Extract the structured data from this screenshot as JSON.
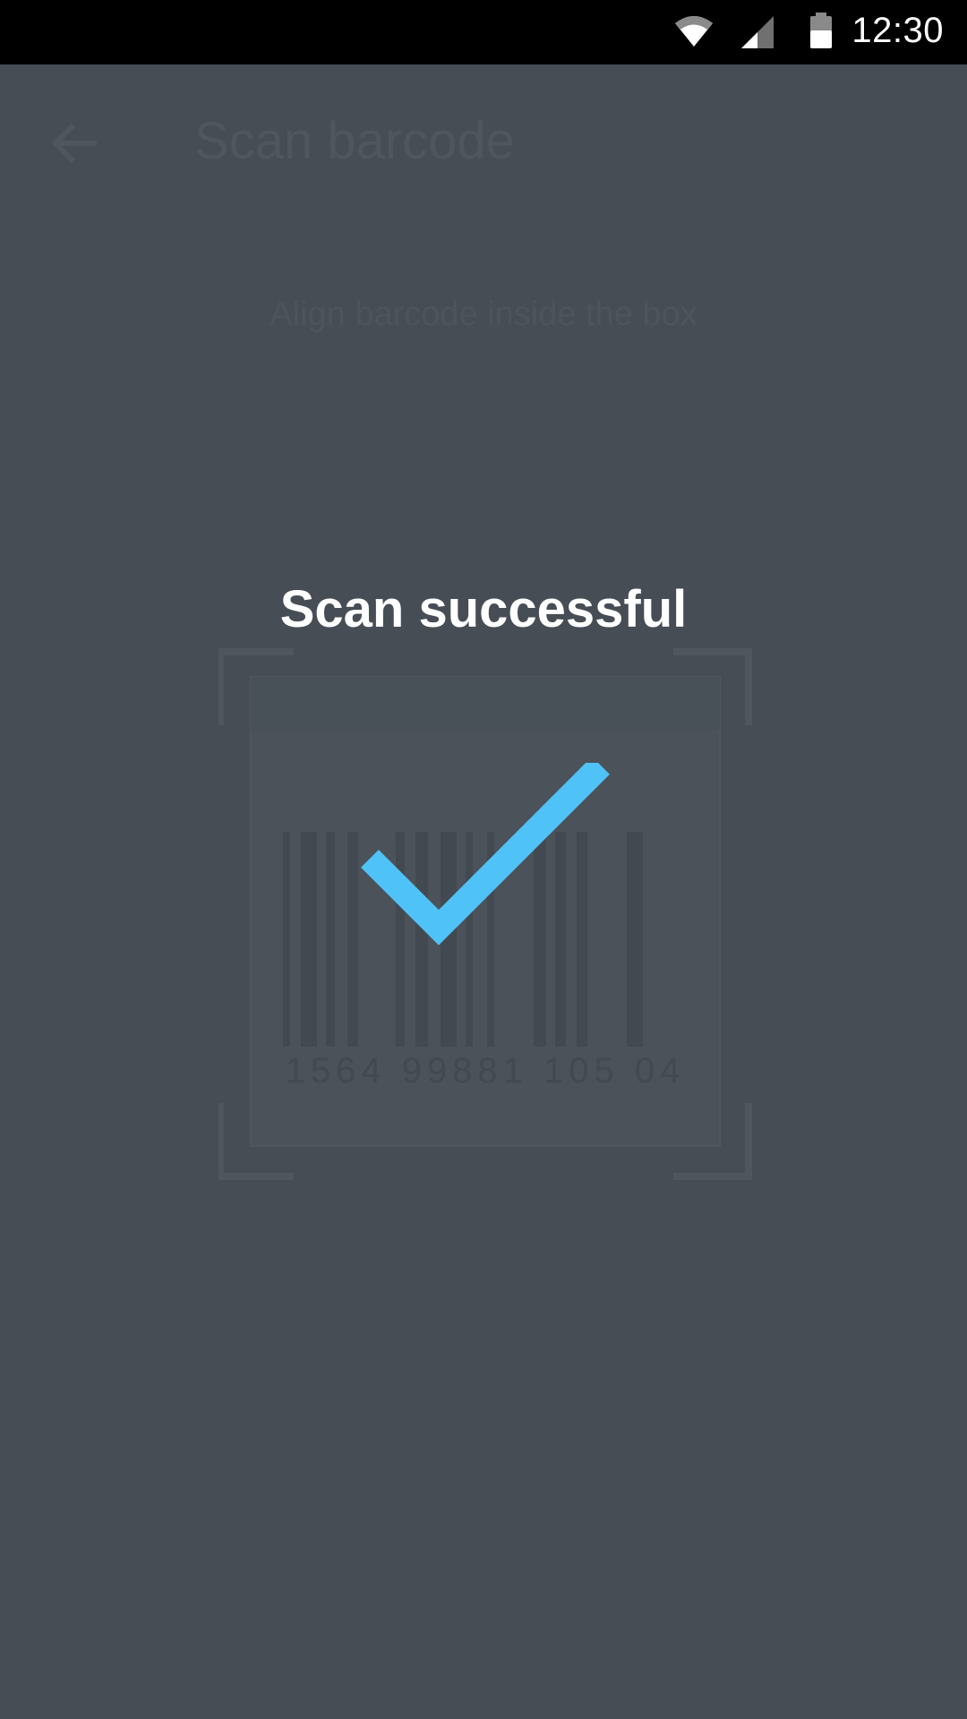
{
  "status_bar": {
    "time": "12:30",
    "icons": [
      "wifi-icon",
      "cellular-signal-icon",
      "battery-icon"
    ]
  },
  "app_bar": {
    "back_icon": "arrow-back-icon",
    "title": "Scan barcode"
  },
  "scanner": {
    "instructions": "Align barcode inside the box",
    "barcode_number": "1564 99881 105 04"
  },
  "result": {
    "title": "Scan successful",
    "icon": "checkmark-icon"
  },
  "colors": {
    "background": "#464d55",
    "accent": "#4fc3f7",
    "status_bar": "#000000",
    "text_on_overlay": "#ffffff"
  }
}
